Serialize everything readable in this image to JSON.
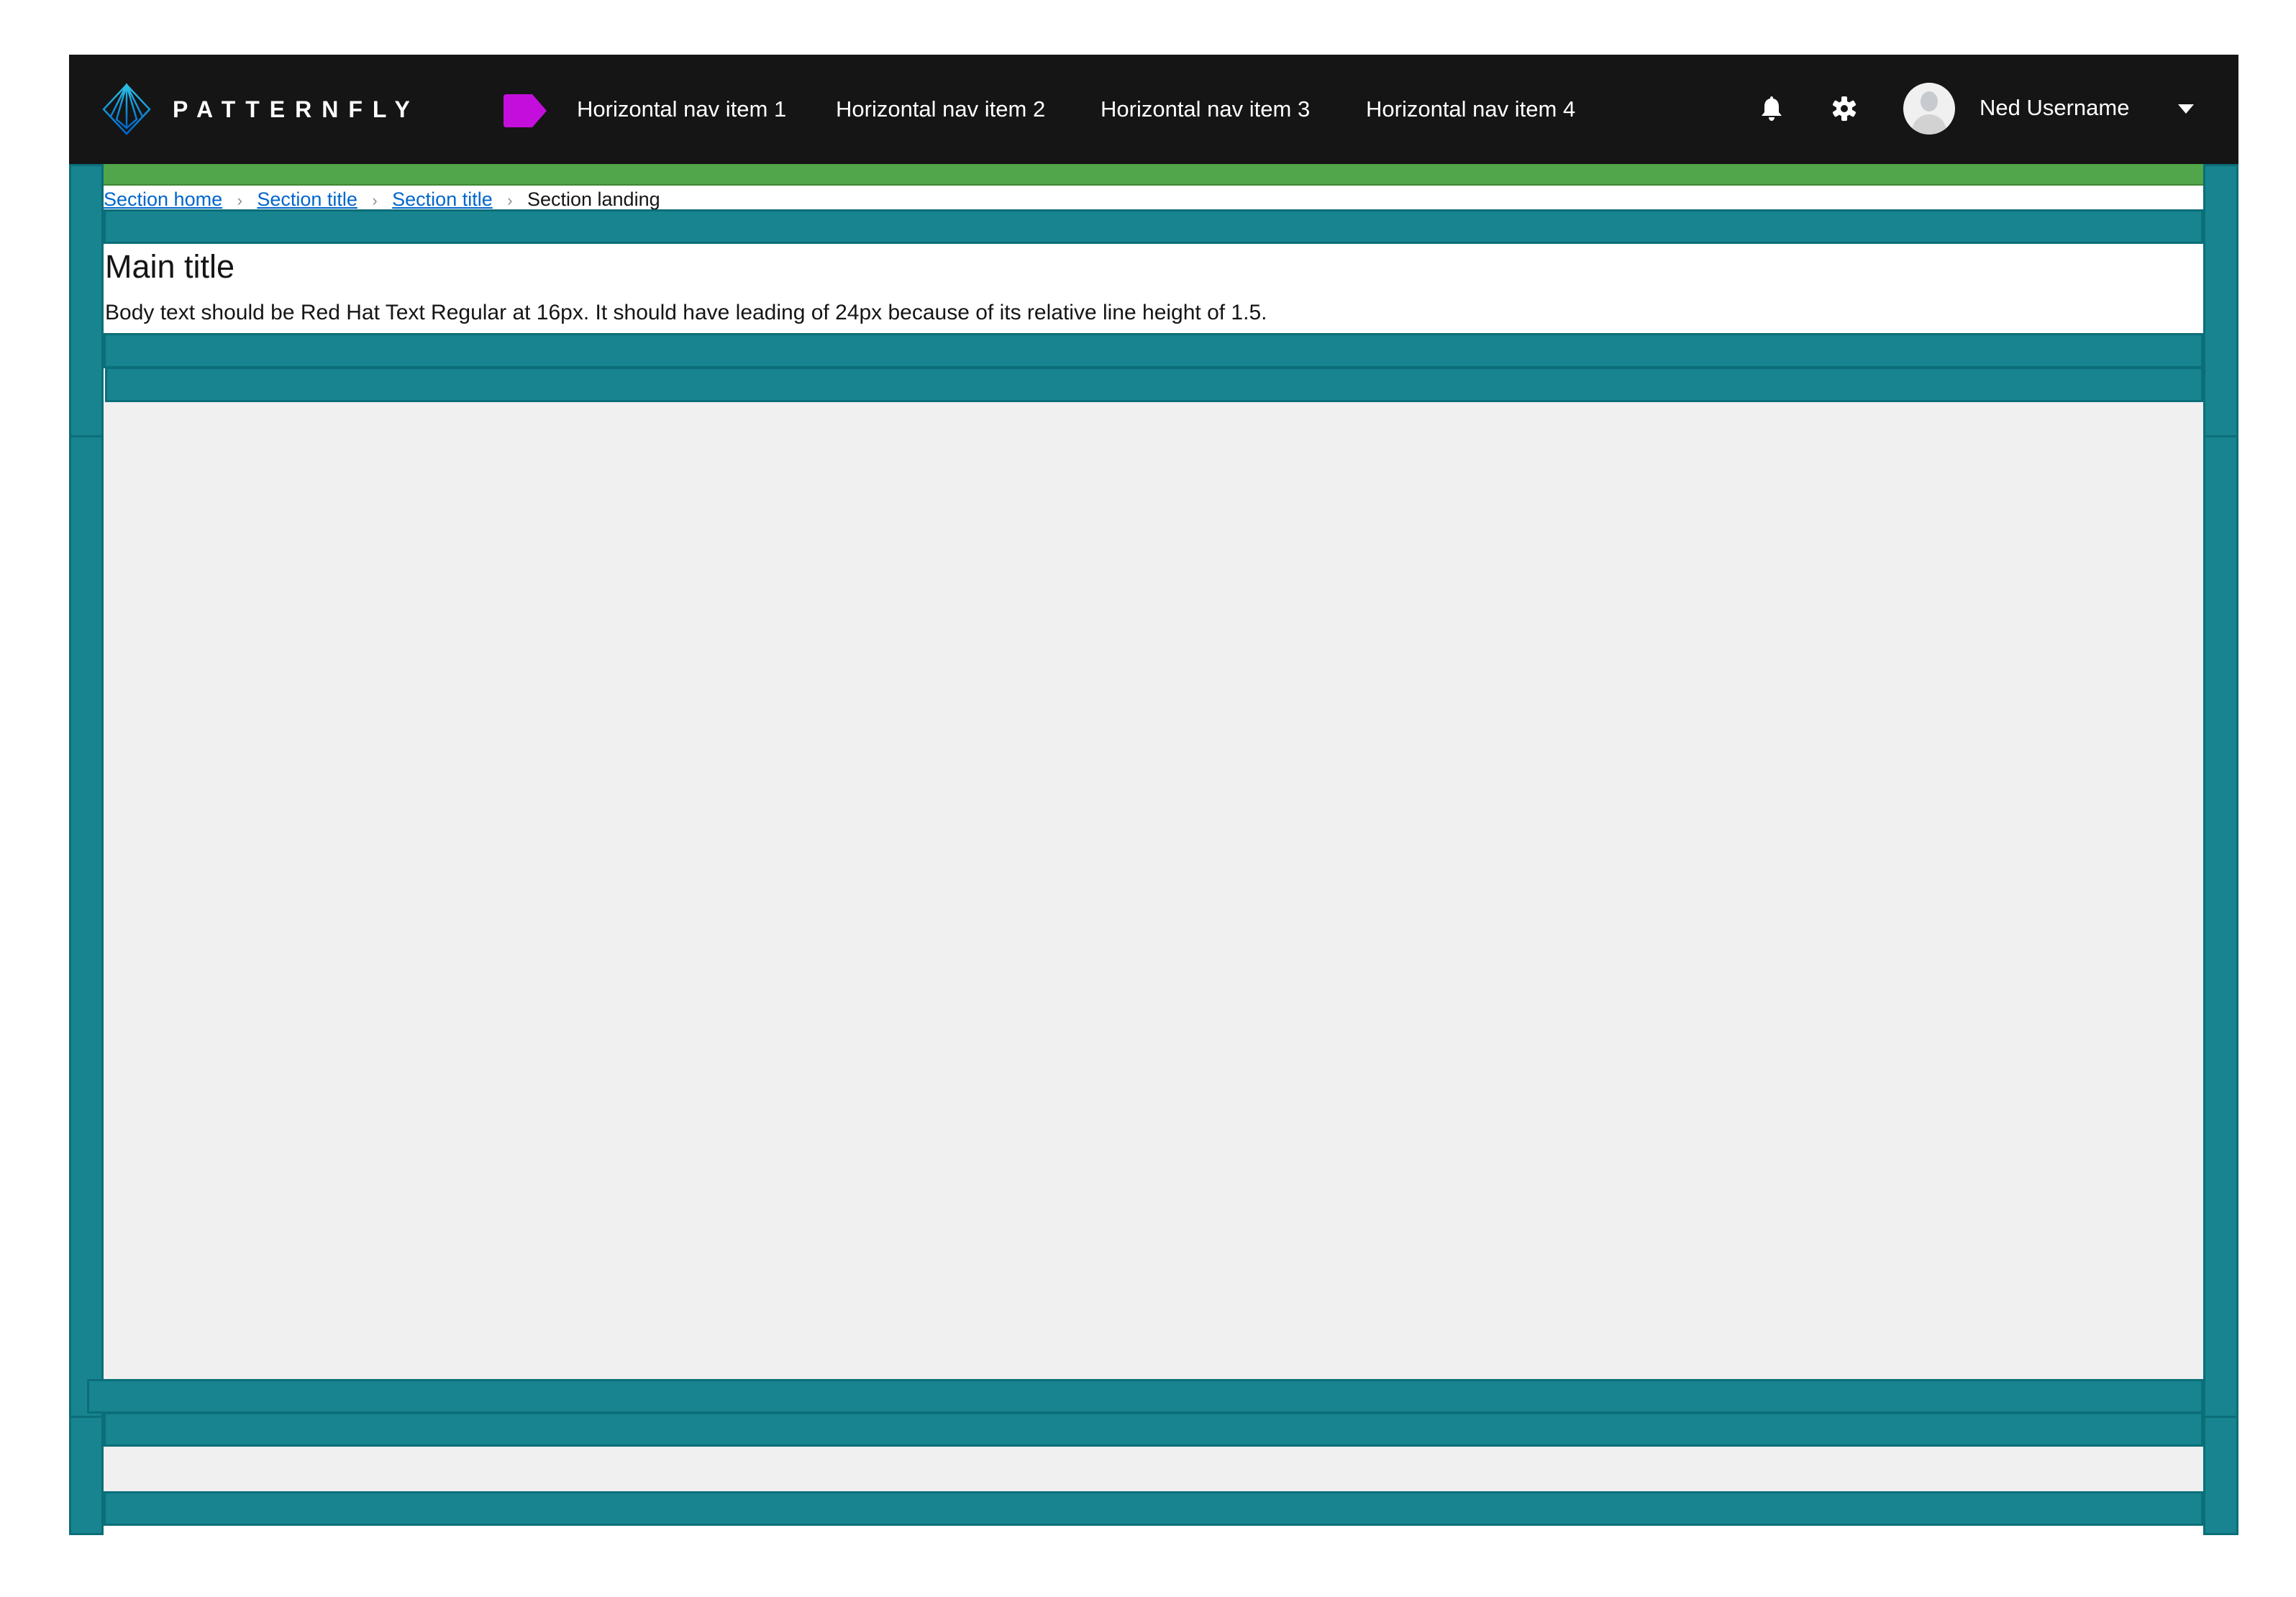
{
  "header": {
    "brand": "PATTERNFLY",
    "nav_items": [
      {
        "label": "Horizontal nav item 1"
      },
      {
        "label": "Horizontal nav item 2"
      },
      {
        "label": "Horizontal nav item 3"
      },
      {
        "label": "Horizontal nav item 4"
      }
    ],
    "user_name": "Ned Username",
    "icons": [
      "bell-icon",
      "gear-icon",
      "avatar",
      "caret-down-icon"
    ]
  },
  "breadcrumb": {
    "items": [
      "Section home",
      "Section title",
      "Section title"
    ],
    "current": "Section landing"
  },
  "main": {
    "title": "Main title",
    "body": "Body text should be Red Hat Text Regular at 16px. It should have leading of 24px because of its relative line height of 1.5."
  },
  "colors": {
    "header_bg": "#151515",
    "teal": "#17848f",
    "green": "#51a54a",
    "link": "#0066cc",
    "accent": "#c40fdc"
  }
}
